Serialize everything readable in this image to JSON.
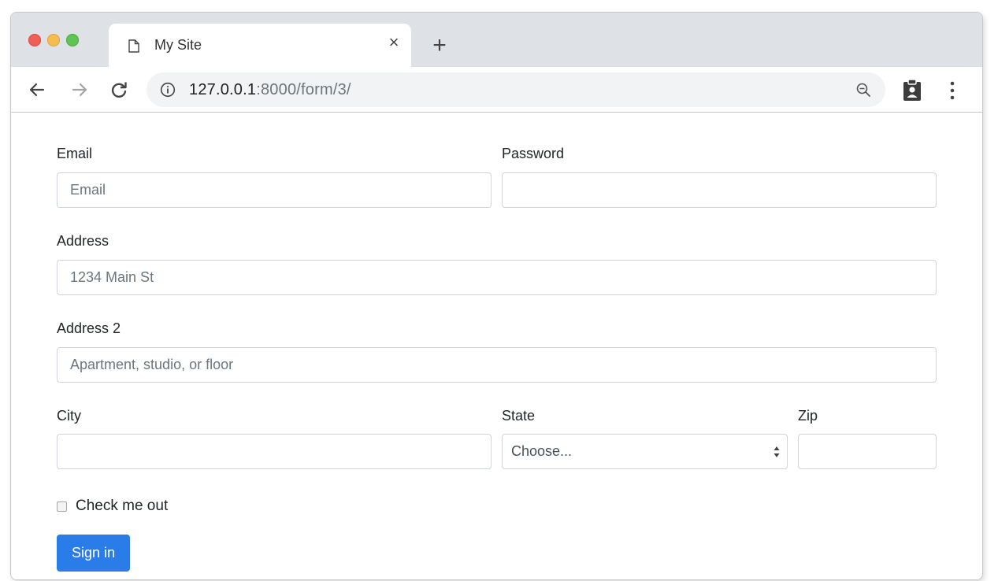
{
  "browser": {
    "tab_title": "My Site",
    "tab_close": "×",
    "new_tab": "+",
    "url_host": "127.0.0.1",
    "url_rest": ":8000/form/3/"
  },
  "form": {
    "email": {
      "label": "Email",
      "placeholder": "Email",
      "value": ""
    },
    "password": {
      "label": "Password",
      "placeholder": "",
      "value": ""
    },
    "address": {
      "label": "Address",
      "placeholder": "1234 Main St",
      "value": ""
    },
    "address2": {
      "label": "Address 2",
      "placeholder": "Apartment, studio, or floor",
      "value": ""
    },
    "city": {
      "label": "City",
      "placeholder": "",
      "value": ""
    },
    "state": {
      "label": "State",
      "selected": "Choose..."
    },
    "zip": {
      "label": "Zip",
      "placeholder": "",
      "value": ""
    },
    "check": {
      "label": "Check me out",
      "checked": false
    },
    "submit_label": "Sign in"
  },
  "colors": {
    "primary": "#2a7ce8",
    "titlebar": "#dee1e6",
    "omnibox": "#f1f3f4",
    "field_border": "#ced4da"
  },
  "icons": [
    "document-icon",
    "close-icon",
    "plus-icon",
    "back-arrow-icon",
    "forward-arrow-icon",
    "reload-icon",
    "info-icon",
    "zoom-out-icon",
    "clipboard-person-icon",
    "kebab-menu-icon",
    "select-arrows-icon"
  ]
}
